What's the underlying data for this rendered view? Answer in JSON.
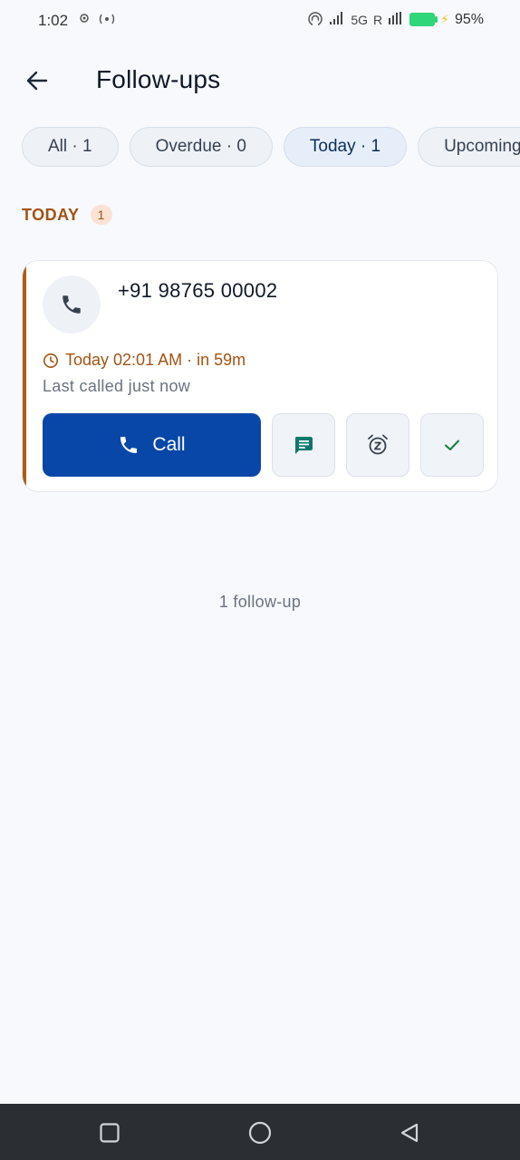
{
  "status_bar": {
    "time": "1:02",
    "network": "5G",
    "roaming": "R",
    "battery_percent": "95%",
    "battery_level": 0.95
  },
  "header": {
    "title": "Follow-ups",
    "back_icon": "arrow-left-icon"
  },
  "filters": [
    {
      "label": "All · 1",
      "active": false
    },
    {
      "label": "Overdue · 0",
      "active": false
    },
    {
      "label": "Today · 1",
      "active": true
    },
    {
      "label": "Upcoming",
      "active": false
    }
  ],
  "section": {
    "label": "TODAY",
    "count": "1"
  },
  "card": {
    "phone_number": "+91 98765 00002",
    "due": "Today 02:01 AM · in 59m",
    "last_called": "Last called just now",
    "call_label": "Call",
    "accent_color": "#b25a12",
    "call_color": "#0847a8"
  },
  "summary": "1 follow-up",
  "colors": {
    "accent_orange": "#a35312",
    "primary_blue": "#0847a8",
    "message_green": "#0f766e",
    "done_green": "#15803d"
  }
}
